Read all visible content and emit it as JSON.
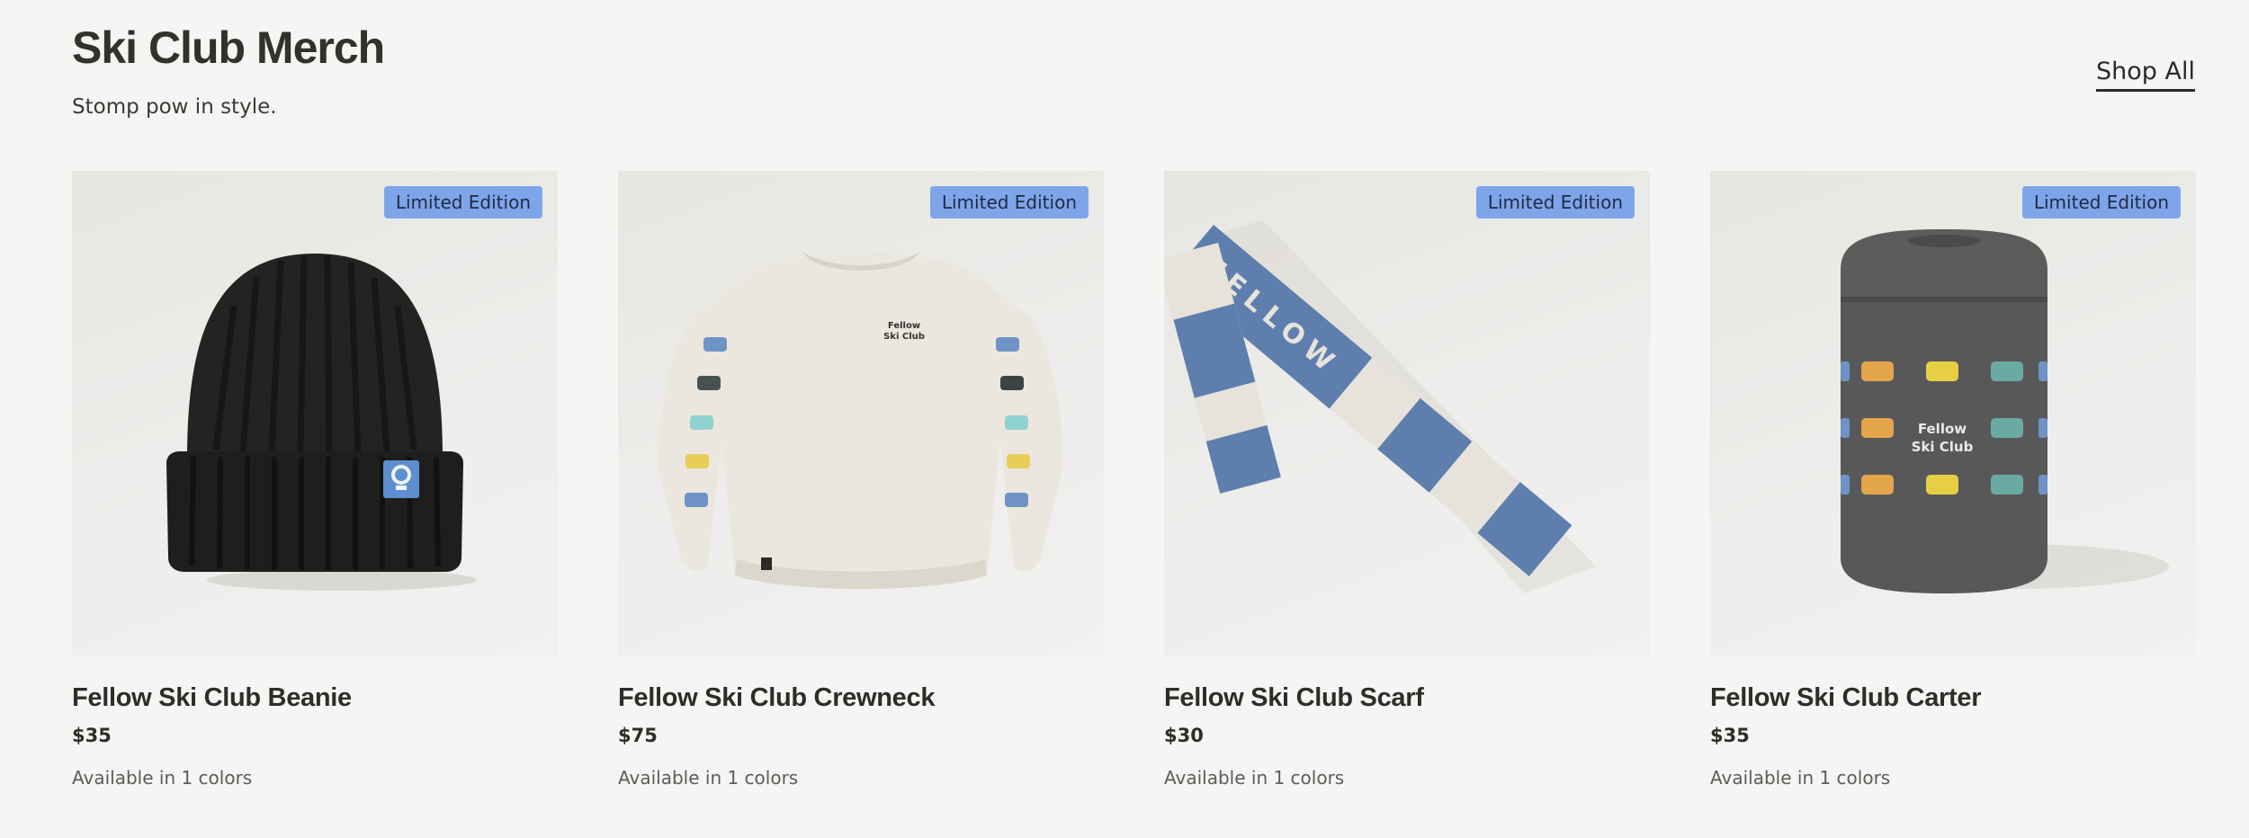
{
  "header": {
    "title": "Ski Club Merch",
    "subtitle": "Stomp pow in style.",
    "shop_all_label": "Shop All"
  },
  "products": [
    {
      "name": "Fellow Ski Club Beanie",
      "price": "$35",
      "colors_text": "Available in 1 colors",
      "badge": "Limited Edition",
      "image_icon": "beanie-image"
    },
    {
      "name": "Fellow Ski Club Crewneck",
      "price": "$75",
      "colors_text": "Available in 1 colors",
      "badge": "Limited Edition",
      "image_icon": "crewneck-image"
    },
    {
      "name": "Fellow Ski Club Scarf",
      "price": "$30",
      "colors_text": "Available in 1 colors",
      "badge": "Limited Edition",
      "image_icon": "scarf-image"
    },
    {
      "name": "Fellow Ski Club Carter",
      "price": "$35",
      "colors_text": "Available in 1 colors",
      "badge": "Limited Edition",
      "image_icon": "carter-mug-image"
    }
  ],
  "product_art": {
    "crewneck_logo_line1": "Fellow",
    "crewneck_logo_line2": "Ski Club",
    "scarf_word": "FELLOW",
    "carter_logo_line1": "Fellow",
    "carter_logo_line2": "Ski Club"
  },
  "colors": {
    "badge_bg": "#7ea5ea",
    "page_bg": "#f5f5f4",
    "text": "#2b2a27"
  }
}
